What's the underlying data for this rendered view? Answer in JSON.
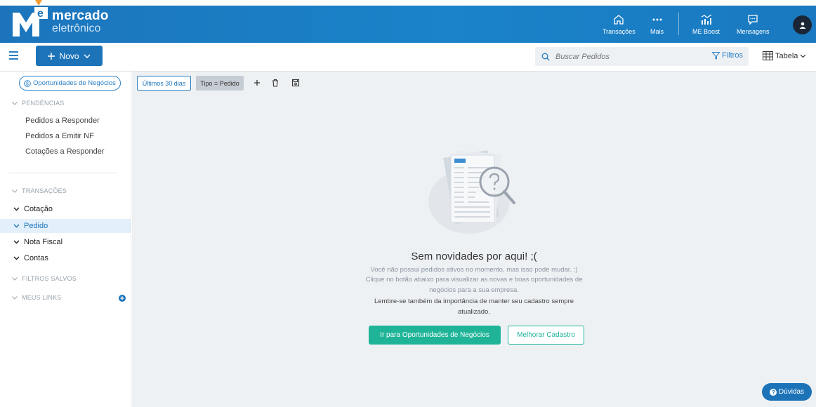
{
  "brand": {
    "logo_letter": "e",
    "name_line1": "mercado",
    "name_line2": "eletrônico"
  },
  "topnav": {
    "transacoes": "Transações",
    "mais": "Mais",
    "me_boost": "ME Boost",
    "mensagens": "Mensagens"
  },
  "toolbar": {
    "novo_label": "Novo",
    "search_placeholder": "Buscar Pedidos",
    "filtros_label": "Filtros",
    "tabela_label": "Tabela"
  },
  "sidebar": {
    "oportunidades_label": "Oportunidades de Negócios",
    "pendencias_title": "PENDÊNCIAS",
    "pendencias_items": [
      "Pedidos a Responder",
      "Pedidos a Emitir NF",
      "Cotações a Responder"
    ],
    "transacoes_title": "TRANSAÇÕES",
    "transacoes_items": [
      "Cotação",
      "Pedido",
      "Nota Fiscal",
      "Contas"
    ],
    "active_item": "Pedido",
    "filtros_salvos_title": "FILTROS SALVOS",
    "meus_links_title": "MEUS LINKS"
  },
  "filters": {
    "chip_period": "Últimos 30 dias",
    "chip_tipo": "Tipo = Pedido"
  },
  "empty_state": {
    "title": "Sem novidades por aqui! ;(",
    "line1": "Você não possui pedidos ativos no momento, mas isso pode mudar. :)",
    "line2": "Clique no botão abaixo para visualizar as novas e boas oportunidades de",
    "line3": "negócios para a sua empresa.",
    "line4": "Lembre-se também da importância de manter seu cadastro sempre",
    "line5": "atualizado.",
    "primary_button": "Ir para Oportunidades de Negócios",
    "secondary_button": "Melhorar Cadastro"
  },
  "help": {
    "duvidas_label": "Dúvidas"
  },
  "colors": {
    "brand_blue": "#1c75bc",
    "accent_green": "#1fb498",
    "pin_orange": "#f29a2e"
  }
}
